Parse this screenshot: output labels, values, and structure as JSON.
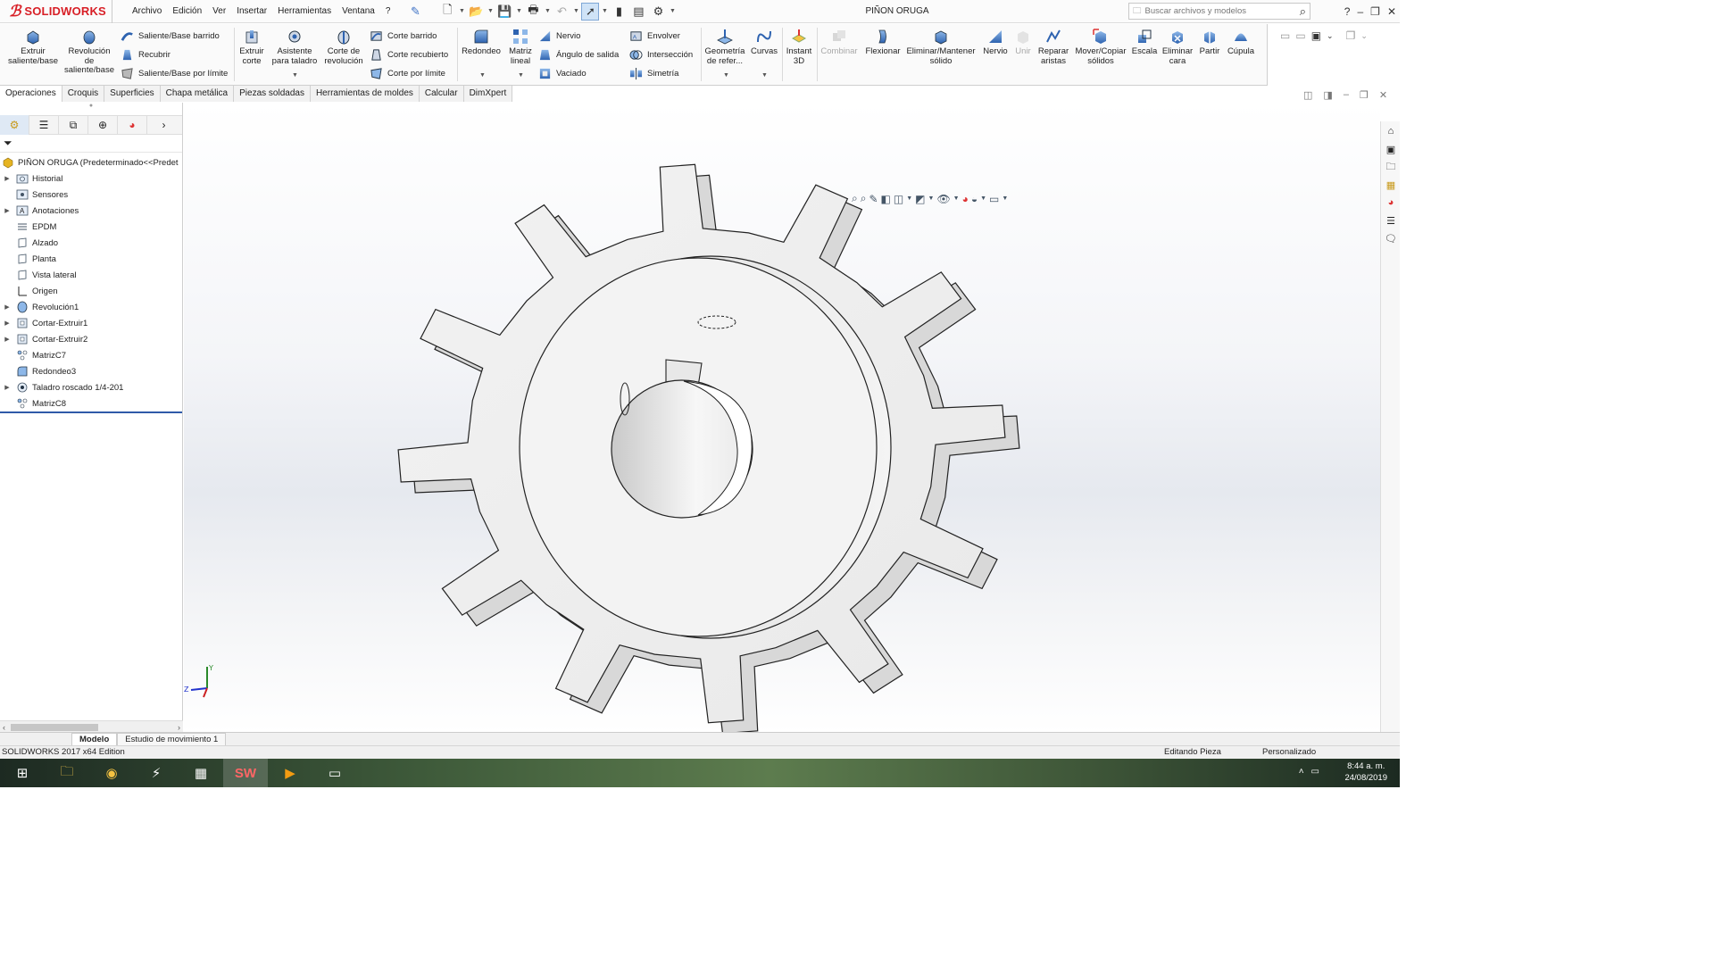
{
  "app": {
    "brand": "SOLIDWORKS",
    "document_title": "PIÑON ORUGA",
    "menus": [
      "Archivo",
      "Edición",
      "Ver",
      "Insertar",
      "Herramientas",
      "Ventana",
      "?"
    ],
    "search_placeholder": "Buscar archivos y modelos"
  },
  "ribbon": {
    "extrude_boss": "Extruir saliente/base",
    "revolve_boss": "Revolución de saliente/base",
    "swept_boss": "Saliente/Base barrido",
    "lofted_boss": "Recubrir",
    "boundary_boss": "Saliente/Base por límite",
    "extruded_cut": "Extruir corte",
    "hole_wizard": "Asistente para taladro",
    "revolved_cut": "Corte de revolución",
    "swept_cut": "Corte barrido",
    "lofted_cut": "Corte recubierto",
    "boundary_cut": "Corte por límite",
    "fillet": "Redondeo",
    "linear_pattern": "Matriz lineal",
    "rib": "Nervio",
    "draft": "Ángulo de salida",
    "shell": "Vaciado",
    "wrap": "Envolver",
    "intersect": "Intersección",
    "mirror": "Simetría",
    "reference_geometry": "Geometría de refer...",
    "curves": "Curvas",
    "instant3d": "Instant 3D",
    "combine": "Combinar",
    "flex": "Flexionar",
    "delete_keep": "Eliminar/Mantener sólido",
    "rib2": "Nervio",
    "join": "Unir",
    "heal_edges": "Reparar aristas",
    "move_copy": "Mover/Copiar sólidos",
    "scale": "Escala",
    "delete_face": "Eliminar cara",
    "split": "Partir",
    "dome": "Cúpula"
  },
  "cm_tabs": [
    "Operaciones",
    "Croquis",
    "Superficies",
    "Chapa metálica",
    "Piezas soldadas",
    "Herramientas de moldes",
    "Calcular",
    "DimXpert"
  ],
  "tree": {
    "root": "PIÑON ORUGA  (Predeterminado<<Predet",
    "items": [
      {
        "label": "Historial",
        "expand": true,
        "icon": "history-folder-icon"
      },
      {
        "label": "Sensores",
        "expand": false,
        "icon": "sensors-icon"
      },
      {
        "label": "Anotaciones",
        "expand": true,
        "icon": "annotations-icon"
      },
      {
        "label": "EPDM",
        "expand": false,
        "icon": "epdm-icon"
      },
      {
        "label": "Alzado",
        "expand": false,
        "icon": "plane-icon"
      },
      {
        "label": "Planta",
        "expand": false,
        "icon": "plane-icon"
      },
      {
        "label": "Vista lateral",
        "expand": false,
        "icon": "plane-icon"
      },
      {
        "label": "Origen",
        "expand": false,
        "icon": "origin-icon"
      },
      {
        "label": "Revolución1",
        "expand": true,
        "icon": "revolve-feature-icon"
      },
      {
        "label": "Cortar-Extruir1",
        "expand": true,
        "icon": "cut-extrude-icon"
      },
      {
        "label": "Cortar-Extruir2",
        "expand": true,
        "icon": "cut-extrude-icon"
      },
      {
        "label": "MatrizC7",
        "expand": false,
        "icon": "circular-pattern-icon"
      },
      {
        "label": "Redondeo3",
        "expand": false,
        "icon": "fillet-feature-icon"
      },
      {
        "label": "Taladro roscado 1/4-201",
        "expand": true,
        "icon": "tapped-hole-icon"
      },
      {
        "label": "MatrizC8",
        "expand": false,
        "icon": "circular-pattern-icon"
      }
    ]
  },
  "bottom_tabs": [
    "Modelo",
    "Estudio de movimiento 1"
  ],
  "status": {
    "edition": "SOLIDWORKS 2017 x64 Edition",
    "mode": "Editando Pieza",
    "units": "Personalizado"
  },
  "taskbar": {
    "time": "8:44 a. m.",
    "date": "24/08/2019"
  },
  "colors": {
    "brand_red": "#d81f26",
    "rollback_bar": "#2f5aa8",
    "active_tool": "#cfe3f7"
  }
}
